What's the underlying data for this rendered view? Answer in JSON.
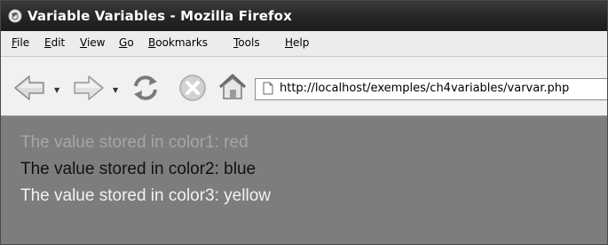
{
  "window": {
    "title": "Variable Variables - Mozilla Firefox"
  },
  "menu": [
    {
      "name": "menu-file",
      "first": "F",
      "rest": "ile"
    },
    {
      "name": "menu-edit",
      "first": "E",
      "rest": "dit"
    },
    {
      "name": "menu-view",
      "first": "V",
      "rest": "iew"
    },
    {
      "name": "menu-go",
      "first": "G",
      "rest": "o"
    },
    {
      "name": "menu-bookmarks",
      "first": "B",
      "rest": "ookmarks"
    },
    {
      "name": "menu-tools",
      "first": "T",
      "rest": "ools"
    },
    {
      "name": "menu-help",
      "first": "H",
      "rest": "elp"
    }
  ],
  "toolbar": {
    "back_icon": "back-arrow-icon",
    "forward_icon": "forward-arrow-icon",
    "reload_icon": "reload-icon",
    "stop_icon": "stop-icon",
    "home_icon": "home-icon"
  },
  "address": {
    "url": "http://localhost/exemples/ch4variables/varvar.php"
  },
  "content": {
    "lines": [
      {
        "text": "The value stored in color1: red",
        "color": "#a6a6a6"
      },
      {
        "text": "The value stored in color2: blue",
        "color": "#111111"
      },
      {
        "text": "The value stored in color3: yellow",
        "color": "#f2f2f2"
      }
    ]
  }
}
